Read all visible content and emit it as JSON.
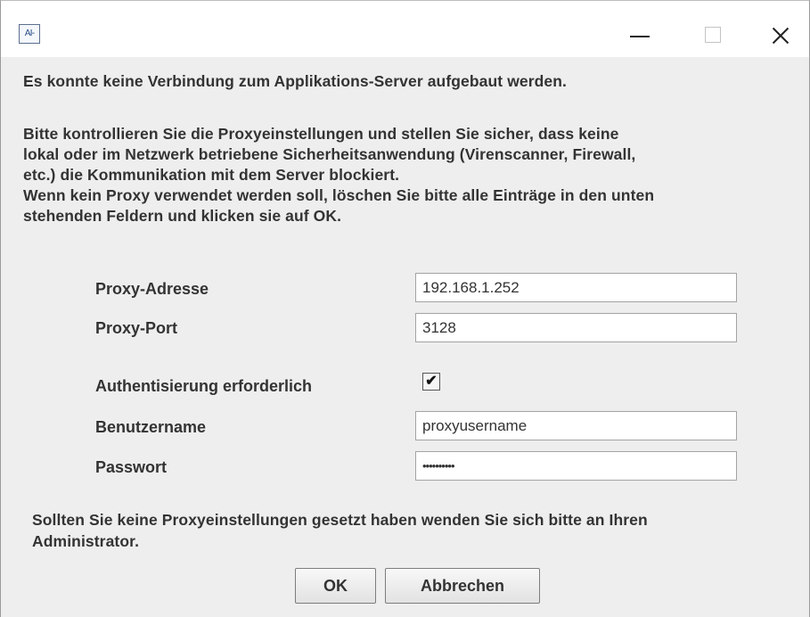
{
  "window": {
    "icon_text": "AI-",
    "controls": {
      "minimize": "minimize",
      "maximize": "maximize",
      "close": "close"
    }
  },
  "message": {
    "headline": "Es konnte keine Verbindung zum Applikations-Server aufgebaut werden.",
    "body_lines": [
      "Bitte kontrollieren Sie die Proxyeinstellungen und stellen Sie sicher, dass keine",
      "lokal oder im Netzwerk betriebene Sicherheitsanwendung (Virenscanner, Firewall,",
      "etc.) die Kommunikation mit dem Server blockiert.",
      "Wenn kein Proxy verwendet werden soll, löschen Sie bitte alle Einträge in den unten",
      "stehenden Feldern und klicken sie auf OK."
    ]
  },
  "form": {
    "proxy_address_label": "Proxy-Adresse",
    "proxy_address_value": "192.168.1.252",
    "proxy_port_label": "Proxy-Port",
    "proxy_port_value": "3128",
    "auth_label": "Authentisierung erforderlich",
    "auth_checked": true,
    "auth_check_glyph": "✔",
    "username_label": "Benutzername",
    "username_value": "proxyusername",
    "password_label": "Passwort",
    "password_value": "••••••••••"
  },
  "footer": {
    "line1": "Sollten Sie keine Proxyeinstellungen gesetzt haben wenden Sie sich bitte an Ihren",
    "line2": "Administrator."
  },
  "buttons": {
    "ok": "OK",
    "cancel": "Abbrechen"
  }
}
